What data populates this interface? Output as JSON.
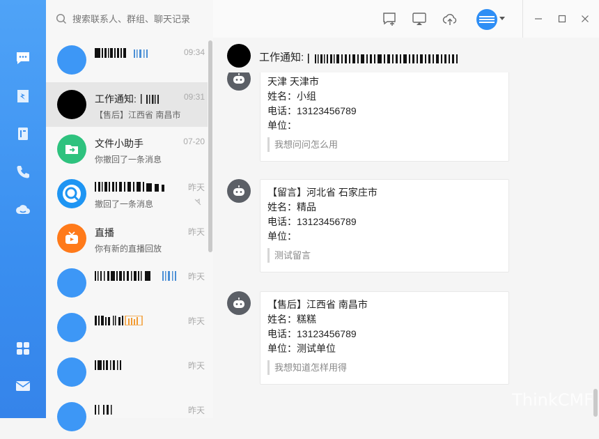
{
  "search": {
    "placeholder": "搜索联系人、群组、聊天记录"
  },
  "conversations": [
    {
      "name": "",
      "time": "09:34",
      "preview": "",
      "avatar_color": "#3d97f6"
    },
    {
      "name": "工作通知:",
      "time": "09:31",
      "preview": "【售后】江西省 南昌市",
      "avatar_color": "#000000"
    },
    {
      "name": "文件小助手",
      "time": "07-20",
      "preview": "你撤回了一条消息",
      "avatar_color": "#2ec27e"
    },
    {
      "name": "",
      "time": "昨天",
      "preview": "撤回了一条消息",
      "avatar_color": "#1e95f3"
    },
    {
      "name": "直播",
      "time": "昨天",
      "preview": "你有新的直播回放",
      "avatar_color": "#ff7a1a"
    },
    {
      "name": "",
      "time": "昨天",
      "preview": "",
      "avatar_color": "#3d97f6"
    },
    {
      "name": "",
      "time": "昨天",
      "preview": "",
      "avatar_color": "#3d97f6"
    },
    {
      "name": "",
      "time": "昨天",
      "preview": "",
      "avatar_color": "#3d97f6"
    },
    {
      "name": "",
      "time": "昨天",
      "preview": "",
      "avatar_color": "#3d97f6"
    }
  ],
  "chat": {
    "title": "工作通知:"
  },
  "messages": [
    {
      "region": "天津 天津市",
      "name": "姓名：小组",
      "phone": "电话：13123456789",
      "unit": "单位：",
      "note": "我想问问怎么用"
    },
    {
      "region": "【留言】河北省 石家庄市",
      "name": "姓名：精品",
      "phone": "电话：13123456789",
      "unit": "单位：",
      "note": "测试留言"
    },
    {
      "region": "【售后】江西省 南昌市",
      "name": "姓名：糕糕",
      "phone": "电话：13123456789",
      "unit": "单位：测试单位",
      "note": "我想知道怎样用得"
    }
  ],
  "watermark": "ThinkCMF",
  "nav_icons": [
    "chat-icon",
    "ding-icon",
    "contacts-icon",
    "phone-icon",
    "cloud-icon",
    "apps-icon",
    "mail-icon"
  ],
  "colors": {
    "nav_blue": "#3a8ff0",
    "accent": "#2e8ef5"
  }
}
